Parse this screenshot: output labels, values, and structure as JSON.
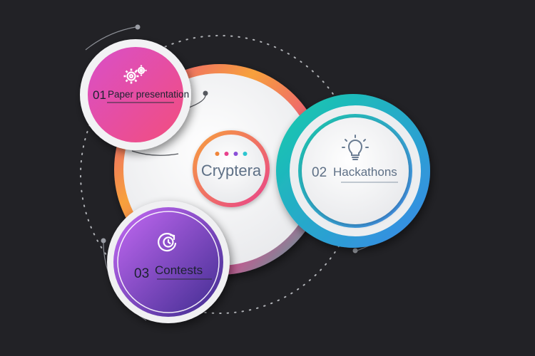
{
  "center": {
    "title": "Cryptera",
    "dot_colors": [
      "#f0853a",
      "#e8418c",
      "#8a4fd8",
      "#2cc6d0"
    ]
  },
  "items": [
    {
      "number": "01",
      "label": "Paper presentation",
      "icon": "gears-icon"
    },
    {
      "number": "02",
      "label": "Hackathons",
      "icon": "lightbulb-icon"
    },
    {
      "number": "03",
      "label": "Contests",
      "icon": "clock-refresh-icon"
    }
  ],
  "colors": {
    "background": "#222226",
    "pink_gradient": [
      "#e84f8f",
      "#c848c8"
    ],
    "teal_gradient": [
      "#18c9b0",
      "#3a8fe8"
    ],
    "purple_gradient": [
      "#b25ff0",
      "#4a2f9a"
    ],
    "ring_gradient": [
      "#f7a13c",
      "#e8418c",
      "#26c2a0"
    ],
    "text": "#5a6c80"
  }
}
